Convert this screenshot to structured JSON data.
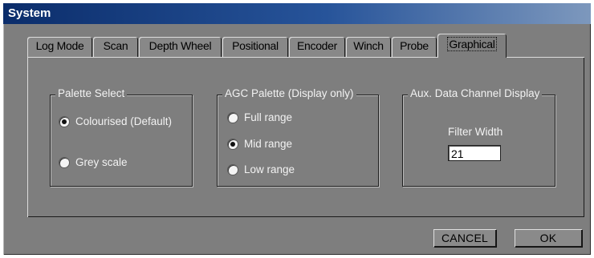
{
  "window": {
    "title": "System"
  },
  "tabs": [
    {
      "label": "Log Mode"
    },
    {
      "label": "Scan"
    },
    {
      "label": "Depth Wheel"
    },
    {
      "label": "Positional"
    },
    {
      "label": "Encoder"
    },
    {
      "label": "Winch"
    },
    {
      "label": "Probe"
    },
    {
      "label": "Graphical",
      "active": true
    }
  ],
  "palette_select": {
    "title": "Palette Select",
    "options": [
      {
        "label": "Colourised (Default)",
        "selected": true
      },
      {
        "label": "Grey scale",
        "selected": false
      }
    ]
  },
  "agc_palette": {
    "title": "AGC Palette (Display only)",
    "options": [
      {
        "label": "Full range",
        "selected": false
      },
      {
        "label": "Mid range",
        "selected": true
      },
      {
        "label": "Low range",
        "selected": false
      }
    ]
  },
  "aux_channel": {
    "title": "Aux. Data Channel Display",
    "filter_label": "Filter Width",
    "filter_value": "21"
  },
  "buttons": {
    "cancel": "CANCEL",
    "ok": "OK"
  }
}
